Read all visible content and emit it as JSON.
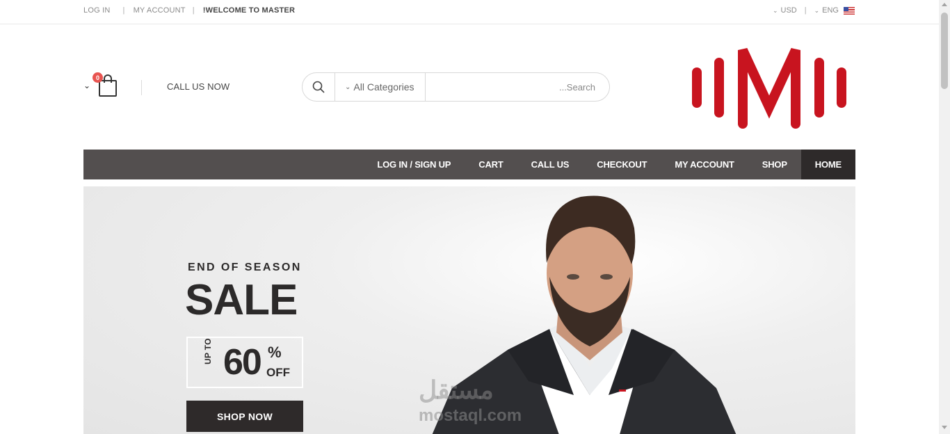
{
  "topbar": {
    "login": "LOG IN",
    "separator": "|",
    "my_account": "MY ACCOUNT",
    "welcome": "!WELCOME TO MASTER",
    "currency": "USD",
    "language": "ENG",
    "chevron": "⌄"
  },
  "header": {
    "cart_count": "0",
    "cart_chevron": "⌄",
    "call_us": "CALL US NOW",
    "search": {
      "category": "All Categories",
      "placeholder": "...Search"
    },
    "logo_color": "#c8141f"
  },
  "nav": {
    "items": [
      {
        "label": "LOG IN / SIGN UP"
      },
      {
        "label": "CART"
      },
      {
        "label": "CALL US"
      },
      {
        "label": "CHECKOUT"
      },
      {
        "label": "MY ACCOUNT"
      },
      {
        "label": "SHOP"
      },
      {
        "label": "HOME",
        "active": true
      }
    ]
  },
  "hero": {
    "eyebrow": "END OF SEASON",
    "headline": "SALE",
    "up_to": "UP TO",
    "percent": "60",
    "percent_sign": "%",
    "off": "OFF",
    "cta": "SHOP NOW",
    "watermark_ar": "مستقل",
    "watermark_en": "mostaql.com"
  },
  "colors": {
    "nav_bg": "#534f4f",
    "nav_active": "#2e2a2a",
    "badge": "#e85450",
    "logo": "#c8141f"
  }
}
